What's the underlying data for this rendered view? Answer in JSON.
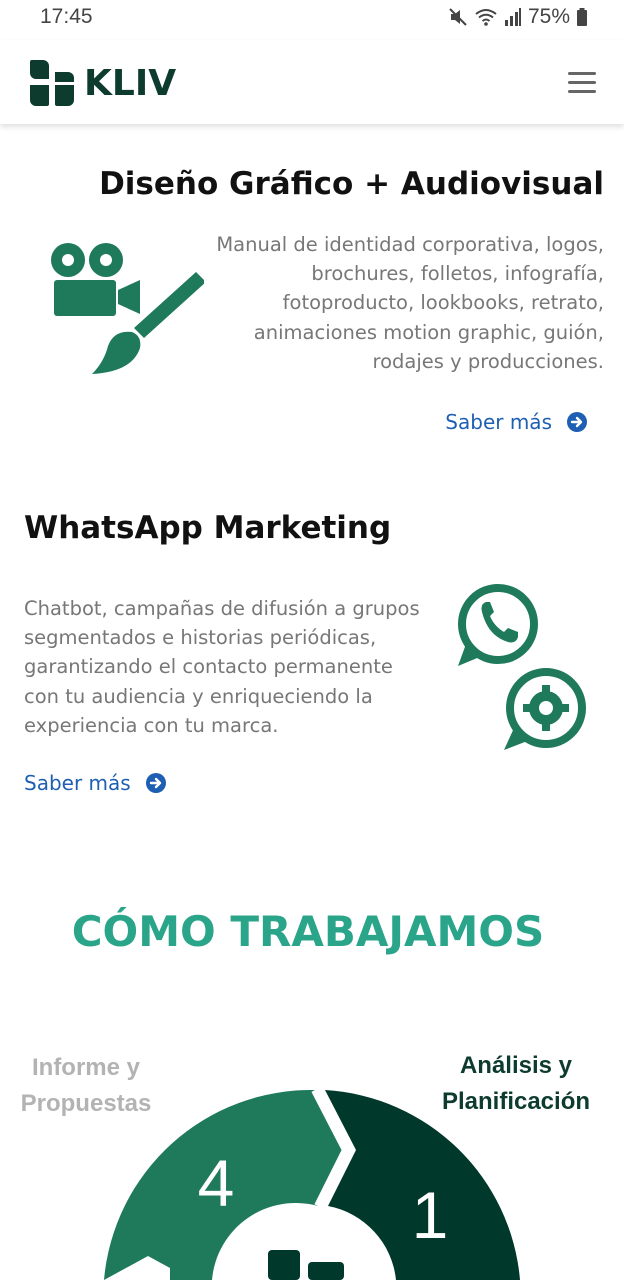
{
  "status_bar": {
    "time": "17:45",
    "battery": "75%"
  },
  "header": {
    "logo_text": "KLIV"
  },
  "services": [
    {
      "title": "Diseño Gráfico + Audiovisual",
      "description": "Manual de identidad corporativa, logos, brochures, folletos, infografía, fotoproducto, lookbooks, retrato, animaciones motion graphic, guión, rodajes y producciones.",
      "link": "Saber más"
    },
    {
      "title": "WhatsApp Marketing",
      "description": "Chatbot, campañas de difusión a grupos segmentados e historias periódicas, garantizando el contacto permanente con tu audiencia y enriqueciendo la experiencia con tu marca.",
      "link": "Saber más"
    }
  ],
  "how_we_work": {
    "title": "CÓMO TRABAJAMOS",
    "steps": [
      {
        "number": "4",
        "label": "Informe y Propuestas"
      },
      {
        "number": "1",
        "label": "Análisis y Planificación"
      }
    ]
  },
  "colors": {
    "brand_dark": "#0d3b2e",
    "brand_green": "#1f7a5c",
    "accent_teal": "#2aa58a",
    "link_blue": "#1e5fb3"
  }
}
